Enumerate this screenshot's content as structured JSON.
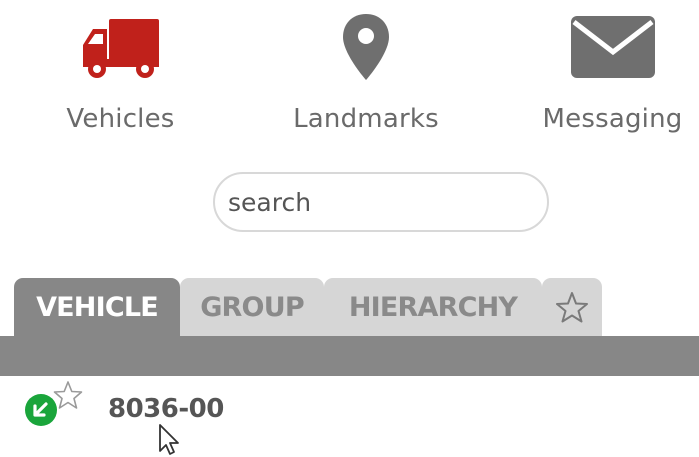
{
  "nav": {
    "vehicles_label": "Vehicles",
    "landmarks_label": "Landmarks",
    "messaging_label": "Messaging",
    "vehicles_icon": "truck-icon",
    "landmarks_icon": "map-pin-icon",
    "messaging_icon": "envelope-icon"
  },
  "search": {
    "placeholder": "search"
  },
  "tabs": [
    {
      "label": "VEHICLE",
      "active": true
    },
    {
      "label": "GROUP",
      "active": false
    },
    {
      "label": "HIERARCHY",
      "active": false
    },
    {
      "label": "☆",
      "icon": "star-icon",
      "active": false
    }
  ],
  "vehicles": [
    {
      "name": "8036-00",
      "status_icon": "moving-status-icon",
      "favorite": false
    }
  ],
  "colors": {
    "accent_red": "#c0211b",
    "icon_gray": "#6f6f6f",
    "tab_active": "#878787",
    "tab_inactive": "#d6d6d6",
    "status_green": "#1aa53b"
  }
}
